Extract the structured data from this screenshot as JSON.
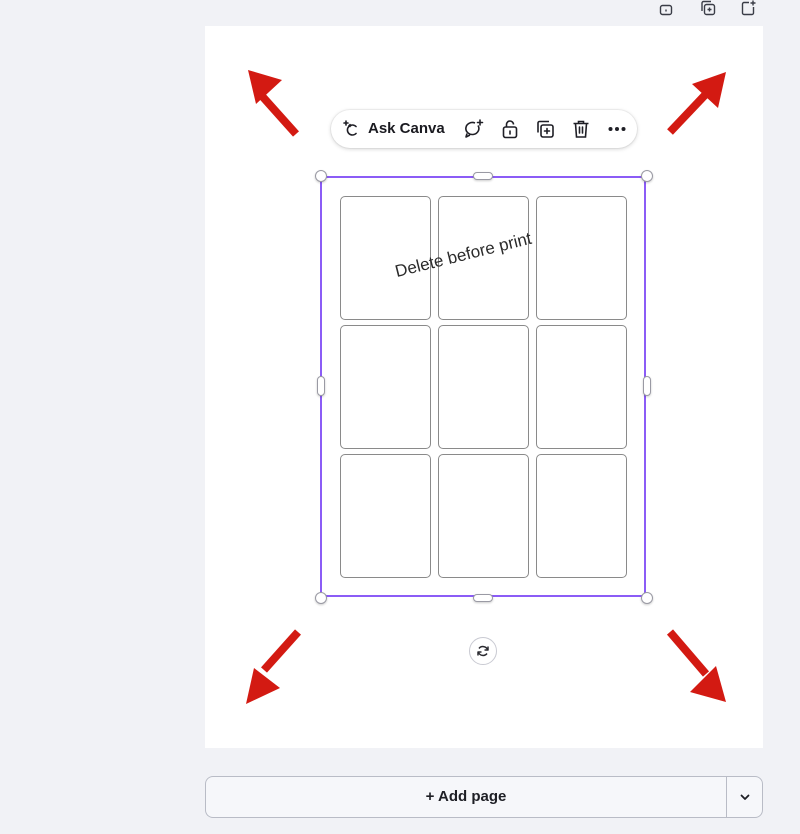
{
  "page_actions": {
    "icons": [
      "lock-icon",
      "duplicate-page-icon",
      "add-page-icon"
    ]
  },
  "element_toolbar": {
    "ask_label": "Ask Canva",
    "icons": [
      "ask-canva-sparkle-icon",
      "comment-icon",
      "lock-icon",
      "duplicate-icon",
      "delete-icon",
      "more-icon"
    ]
  },
  "canvas": {
    "grid_rows": 3,
    "grid_cols": 3,
    "watermark_text": "Delete before print",
    "accent_color": "#8b5cf6",
    "arrow_color": "#d31a12"
  },
  "footer": {
    "add_page_label": "+ Add page"
  }
}
